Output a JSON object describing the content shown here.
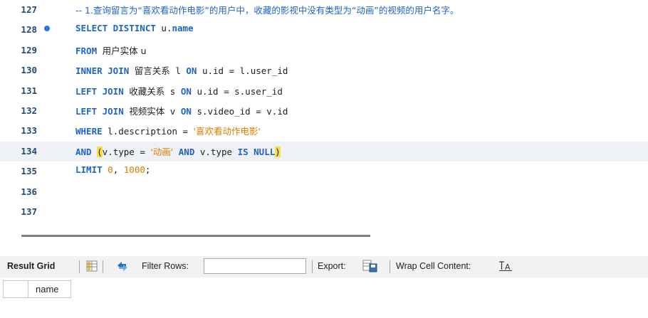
{
  "editor": {
    "lines": [
      {
        "num": "127",
        "marker": false,
        "current": false,
        "tokens": [
          {
            "t": "-- 1.查询留言为“喜欢看动作电影”的用户中，收藏的影视中没有类型为“动画”的视频的用户名字。",
            "c": "cm cjk"
          }
        ]
      },
      {
        "num": "128",
        "marker": true,
        "current": false,
        "tokens": [
          {
            "t": "SELECT DISTINCT",
            "c": "kw"
          },
          {
            "t": " u.",
            "c": ""
          },
          {
            "t": "name",
            "c": "kw"
          }
        ]
      },
      {
        "num": "129",
        "marker": false,
        "current": false,
        "tokens": [
          {
            "t": "FROM",
            "c": "kw"
          },
          {
            "t": " ",
            "c": ""
          },
          {
            "t": "用户实体 u",
            "c": "cjk"
          }
        ]
      },
      {
        "num": "130",
        "marker": false,
        "current": false,
        "tokens": [
          {
            "t": "INNER JOIN",
            "c": "kw"
          },
          {
            "t": " ",
            "c": ""
          },
          {
            "t": "留言关系",
            "c": "cjk"
          },
          {
            "t": " l ",
            "c": ""
          },
          {
            "t": "ON",
            "c": "kw"
          },
          {
            "t": " u.id = l.user_id",
            "c": ""
          }
        ]
      },
      {
        "num": "131",
        "marker": false,
        "current": false,
        "tokens": [
          {
            "t": "LEFT JOIN",
            "c": "kw"
          },
          {
            "t": " ",
            "c": ""
          },
          {
            "t": "收藏关系",
            "c": "cjk"
          },
          {
            "t": " s ",
            "c": ""
          },
          {
            "t": "ON",
            "c": "kw"
          },
          {
            "t": " u.id = s.user_id",
            "c": ""
          }
        ]
      },
      {
        "num": "132",
        "marker": false,
        "current": false,
        "tokens": [
          {
            "t": "LEFT JOIN",
            "c": "kw"
          },
          {
            "t": " ",
            "c": ""
          },
          {
            "t": "视频实体",
            "c": "cjk"
          },
          {
            "t": " v ",
            "c": ""
          },
          {
            "t": "ON",
            "c": "kw"
          },
          {
            "t": " s.video_id = v.id",
            "c": ""
          }
        ]
      },
      {
        "num": "133",
        "marker": false,
        "current": false,
        "tokens": [
          {
            "t": "WHERE",
            "c": "kw"
          },
          {
            "t": " l.description = ",
            "c": ""
          },
          {
            "t": "'喜欢看动作电影'",
            "c": "str cjk"
          }
        ]
      },
      {
        "num": "134",
        "marker": false,
        "current": true,
        "tokens": [
          {
            "t": "AND",
            "c": "kw"
          },
          {
            "t": " ",
            "c": ""
          },
          {
            "t": "(",
            "c": "bracket"
          },
          {
            "t": "v.type = ",
            "c": ""
          },
          {
            "t": "'动画'",
            "c": "str cjk"
          },
          {
            "t": " ",
            "c": ""
          },
          {
            "t": "AND",
            "c": "kw"
          },
          {
            "t": " v.type ",
            "c": ""
          },
          {
            "t": "IS NULL",
            "c": "kw"
          },
          {
            "t": ")",
            "c": "bracket"
          }
        ]
      },
      {
        "num": "135",
        "marker": false,
        "current": false,
        "tokens": [
          {
            "t": "LIMIT",
            "c": "kw"
          },
          {
            "t": " ",
            "c": ""
          },
          {
            "t": "0",
            "c": "num"
          },
          {
            "t": ", ",
            "c": ""
          },
          {
            "t": "1000",
            "c": "num"
          },
          {
            "t": ";",
            "c": ""
          }
        ]
      },
      {
        "num": "136",
        "marker": false,
        "current": false,
        "tokens": []
      },
      {
        "num": "137",
        "marker": false,
        "current": false,
        "tokens": []
      }
    ]
  },
  "toolbar": {
    "result_grid_label": "Result Grid",
    "form_editor_icon": "form-editor-icon",
    "refresh_icon": "refresh-arrows-icon",
    "filter_label": "Filter Rows:",
    "filter_value": "",
    "export_label": "Export:",
    "export_icon": "export-grid-icon",
    "wrap_label": "Wrap Cell Content:",
    "wrap_icon": "wrap-text-icon"
  },
  "grid": {
    "columns": [
      "name"
    ]
  },
  "colors": {
    "keyword": "#1f63c8",
    "string": "#e07b00",
    "line_number": "#234a73",
    "current_line": "#eef1f5",
    "bracket_match": "#f5e04a",
    "toolbar_bg": "#f2f2f2"
  }
}
